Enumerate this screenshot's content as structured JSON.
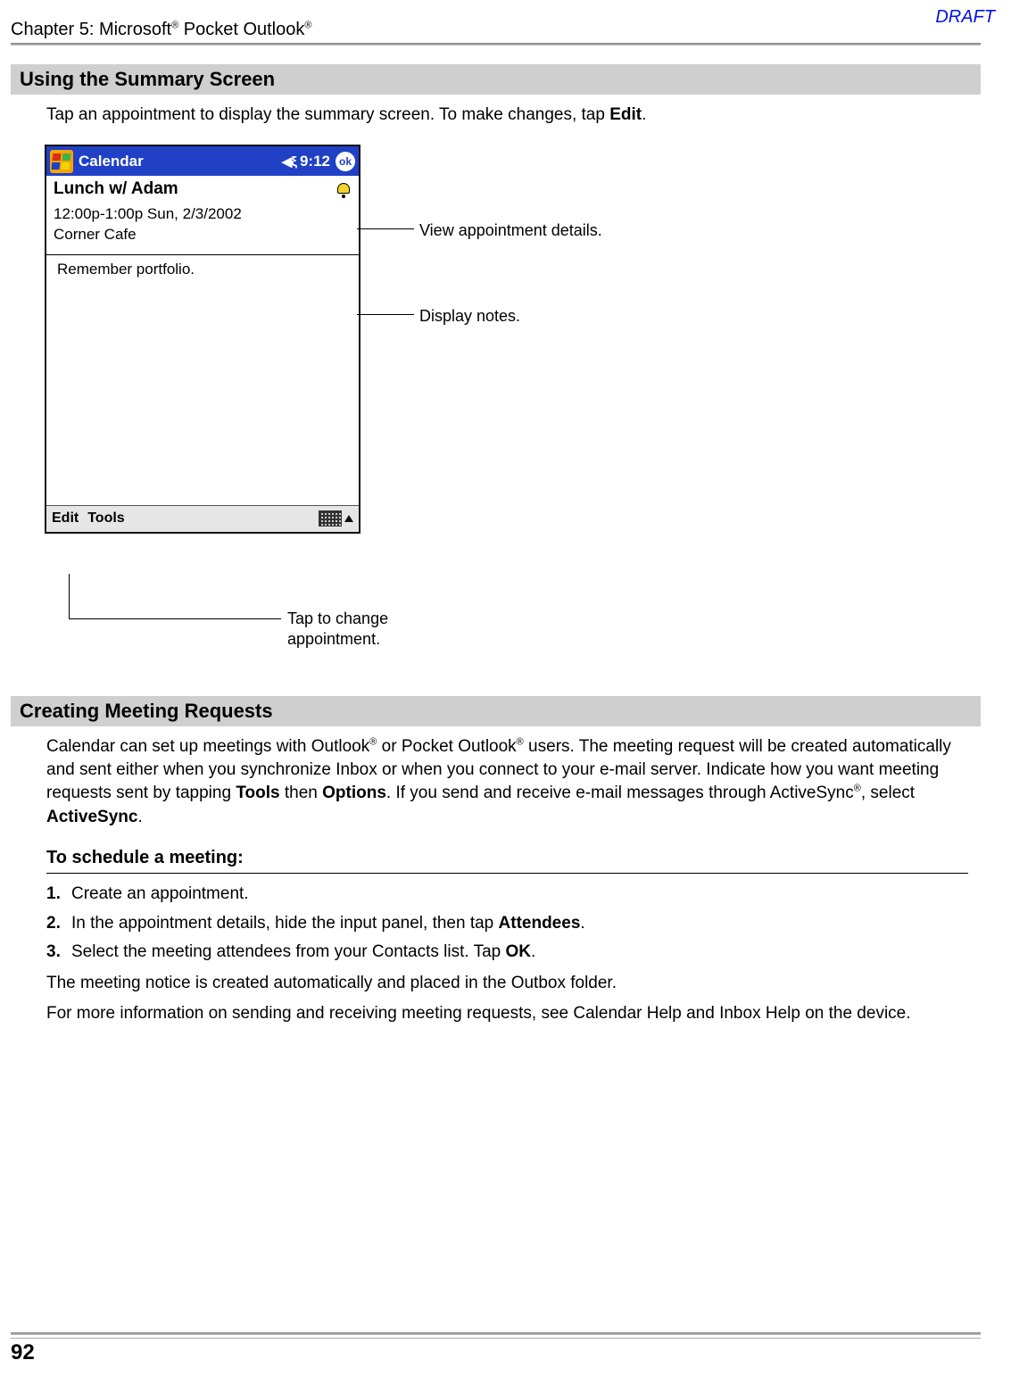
{
  "header": {
    "chapter_prefix": "Chapter 5: Microsoft",
    "reg1": "®",
    "mid": " Pocket Outlook",
    "reg2": "®",
    "draft": "DRAFT",
    "page_number": "92"
  },
  "section1": {
    "title": "Using the Summary Screen",
    "intro_a": "Tap an appointment to display the summary screen. To make changes, tap ",
    "intro_b_bold": "Edit",
    "intro_c": "."
  },
  "screenshot": {
    "titlebar_label": "Calendar",
    "time": "9:12",
    "ok": "ok",
    "subject": "Lunch w/ Adam",
    "detail_line1": "12:00p-1:00p Sun, 2/3/2002",
    "detail_line2": "Corner Cafe",
    "note_text": "Remember portfolio.",
    "menu_edit": "Edit",
    "menu_tools": "Tools",
    "speaker": "◀ξ"
  },
  "annotations": {
    "details": "View appointment details.",
    "notes": "Display notes.",
    "edit_line1": "Tap to change",
    "edit_line2": "appointment."
  },
  "section2": {
    "title": "Creating Meeting Requests",
    "para_a": "Calendar can set up meetings with Outlook",
    "reg_a": "®",
    "para_b": " or Pocket Outlook",
    "reg_b": "®",
    "para_c": " users. The meeting request will be created automatically and sent either when you synchronize Inbox or when you connect to your e-mail server. Indicate how you want meeting requests sent by tapping ",
    "bold_tools": "Tools",
    "para_d": " then ",
    "bold_options": "Options",
    "para_e": ". If you send and receive e-mail messages through ActiveSync",
    "reg_c": "®",
    "para_f": ", select ",
    "bold_as": "ActiveSync",
    "para_g": "."
  },
  "schedule": {
    "heading": "To schedule a meeting:",
    "s1_n": "1.",
    "s1_t": "Create an appointment.",
    "s2_n": "2.",
    "s2_a": "In the appointment details, hide the input panel, then tap ",
    "s2_b": "Attendees",
    "s2_c": ".",
    "s3_n": "3.",
    "s3_a": "Select the meeting attendees from your Contacts list. Tap ",
    "s3_b": "OK",
    "s3_c": ".",
    "tail1": "The meeting notice is created automatically and placed in the Outbox folder.",
    "tail2": "For more information on sending and receiving meeting requests, see Calendar Help and Inbox Help on the device."
  }
}
